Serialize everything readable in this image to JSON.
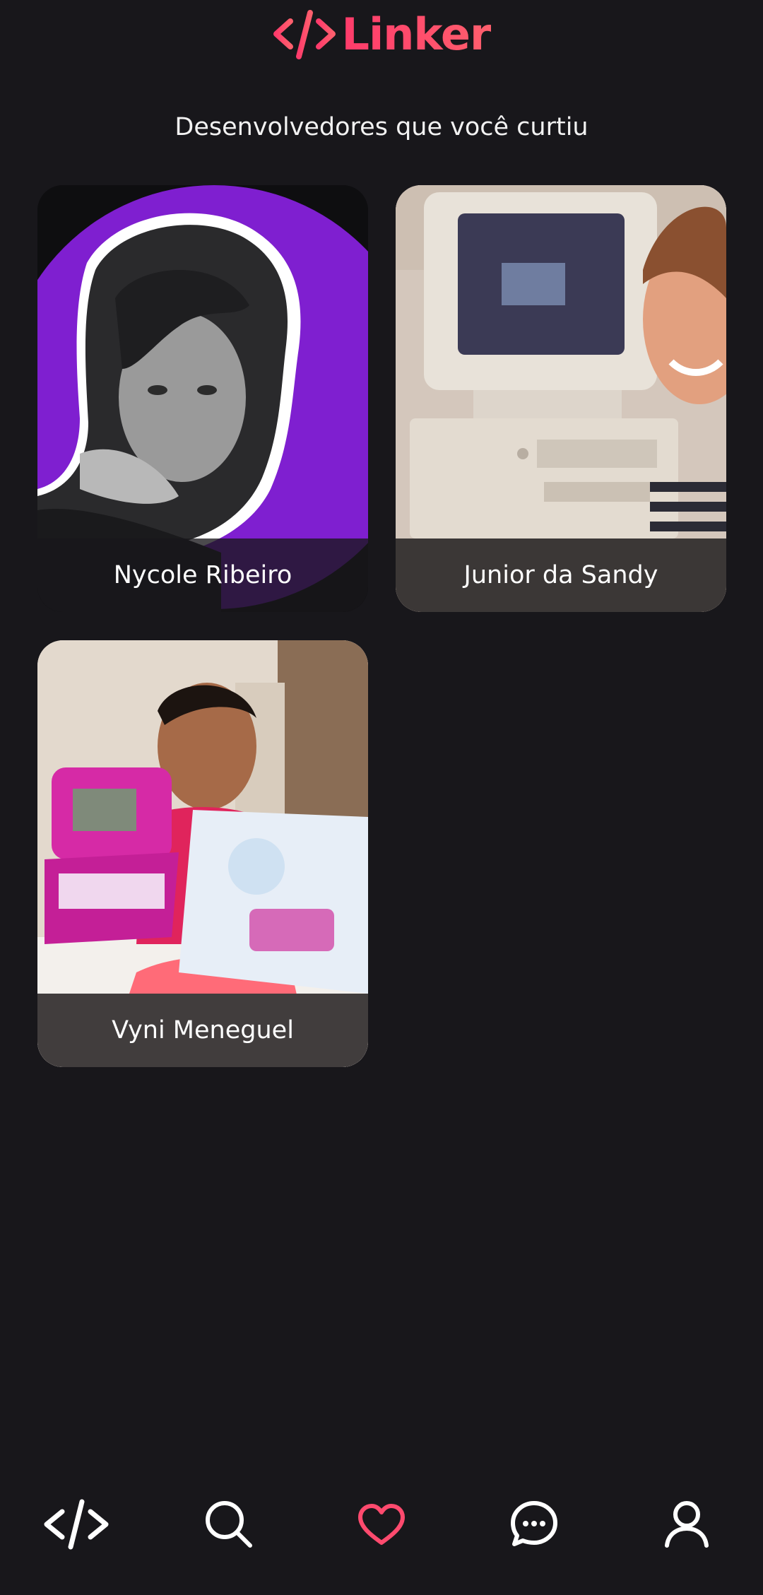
{
  "app": {
    "logo_text": "Linker",
    "brand_color": "#ff4a6e"
  },
  "page": {
    "title": "Desenvolvedores que você curtiu"
  },
  "liked_developers": [
    {
      "name": "Nycole Ribeiro"
    },
    {
      "name": "Junior da Sandy"
    },
    {
      "name": "Vyni Meneguel"
    }
  ],
  "bottom_nav": {
    "items": [
      {
        "icon": "code-icon",
        "active": false
      },
      {
        "icon": "search-icon",
        "active": false
      },
      {
        "icon": "heart-icon",
        "active": true
      },
      {
        "icon": "chat-icon",
        "active": false
      },
      {
        "icon": "user-icon",
        "active": false
      }
    ],
    "active_color": "#ff4a6e",
    "inactive_color": "#ffffff"
  }
}
